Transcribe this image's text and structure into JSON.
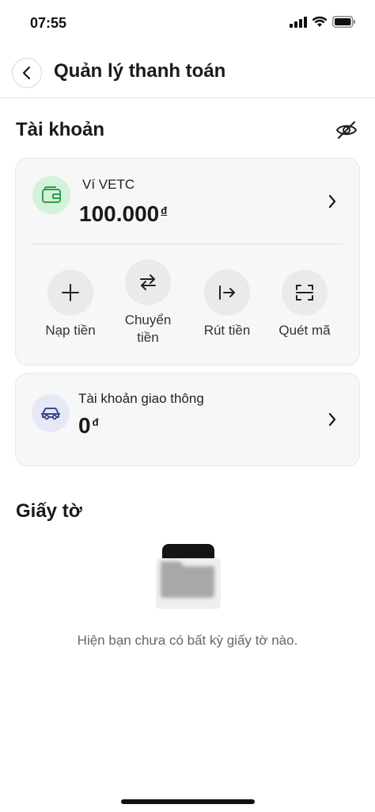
{
  "status_bar": {
    "time": "07:55"
  },
  "header": {
    "title": "Quản lý thanh toán"
  },
  "accounts": {
    "section_title": "Tài khoản",
    "wallet": {
      "name": "Ví VETC",
      "amount": "100.000",
      "currency": "đ",
      "actions": [
        {
          "label": "Nạp tiền",
          "icon": "plus-icon"
        },
        {
          "label": "Chuyển tiền",
          "icon": "transfer-icon"
        },
        {
          "label": "Rút tiền",
          "icon": "withdraw-icon"
        },
        {
          "label": "Quét mã",
          "icon": "scan-icon"
        }
      ]
    },
    "traffic_account": {
      "name": "Tài khoản giao thông",
      "amount": "0",
      "currency": "đ"
    }
  },
  "documents": {
    "section_title": "Giấy tờ",
    "empty_message": "Hiện bạn chưa có bất kỳ giấy tờ nào."
  },
  "colors": {
    "wallet_icon_bg": "#d4f1d9",
    "wallet_icon_fg": "#2e9e4b",
    "traffic_icon_bg": "#e6e8f6",
    "traffic_icon_fg": "#3b4a8f"
  }
}
